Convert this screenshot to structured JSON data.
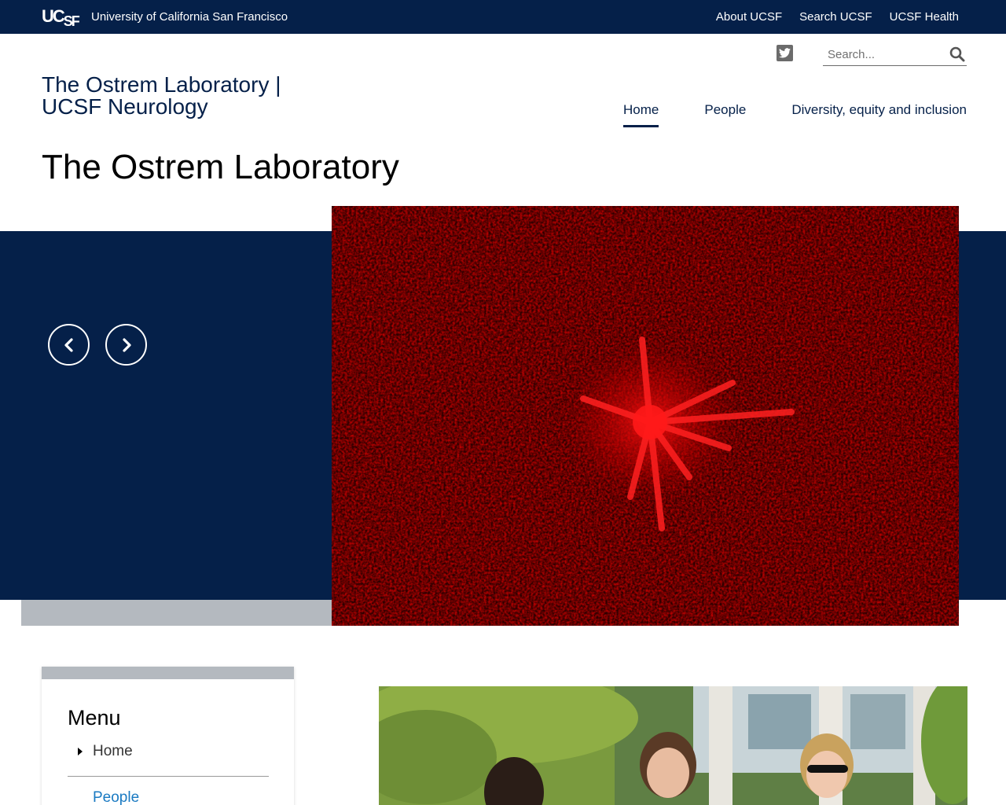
{
  "topbar": {
    "logo_text": "UCSF",
    "university_name": "University of California San Francisco",
    "links": [
      "About UCSF",
      "Search UCSF",
      "UCSF Health"
    ]
  },
  "header": {
    "site_title_line1": "The Ostrem Laboratory |",
    "site_title_line2": "UCSF Neurology",
    "search_placeholder": "Search...",
    "nav": [
      {
        "label": "Home",
        "active": true
      },
      {
        "label": "People",
        "active": false
      },
      {
        "label": "Diversity, equity and inclusion",
        "active": false
      }
    ]
  },
  "page": {
    "title": "The Ostrem Laboratory"
  },
  "sidebar": {
    "title": "Menu",
    "items": [
      "Home",
      "People"
    ]
  },
  "colors": {
    "navy": "#052049",
    "gray": "#b4b9bf",
    "link_blue": "#1a7ac2"
  },
  "icons": [
    "twitter-icon",
    "search-icon",
    "chevron-left-icon",
    "chevron-right-icon",
    "caret-right-icon"
  ]
}
